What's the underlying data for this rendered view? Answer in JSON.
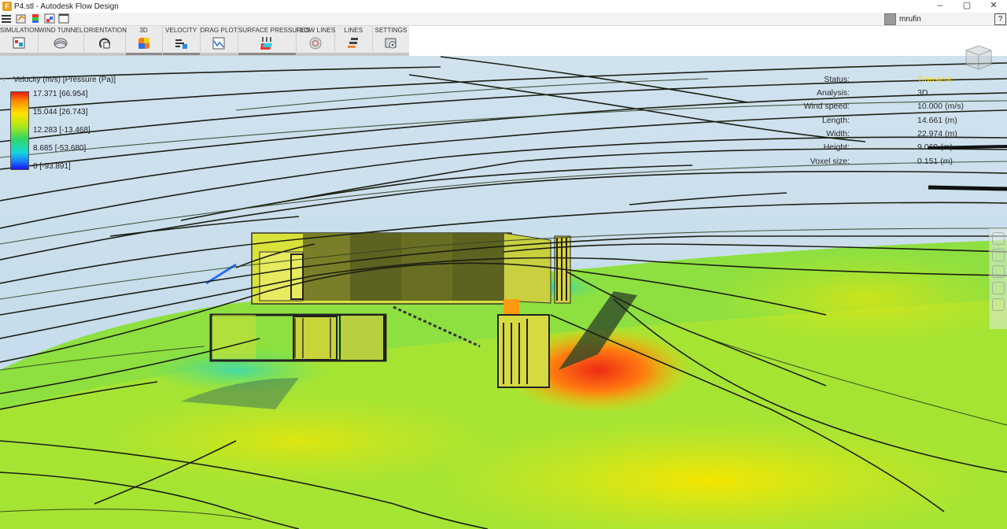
{
  "window": {
    "title": "P4.stl - Autodesk Flow Design",
    "controls": [
      "–",
      "▢",
      "✕"
    ]
  },
  "quickbar": {
    "user": "mrufin",
    "help": "?"
  },
  "ribbon": {
    "tabs": [
      {
        "label": "SIMULATION",
        "icon": "simulation-icon"
      },
      {
        "label": "WIND TUNNEL",
        "icon": "wind-tunnel-icon"
      },
      {
        "label": "ORIENTATION",
        "icon": "orientation-icon"
      },
      {
        "label": "3D",
        "icon": "3d-icon"
      },
      {
        "label": "VELOCITY",
        "icon": "velocity-icon"
      },
      {
        "label": "DRAG PLOT",
        "icon": "drag-plot-icon"
      },
      {
        "label": "SURFACE PRESSURES",
        "icon": "surface-pressures-icon"
      },
      {
        "label": "FLOW LINES",
        "icon": "flow-lines-icon"
      },
      {
        "label": "LINES",
        "icon": "lines-icon"
      },
      {
        "label": "SETTINGS",
        "icon": "settings-icon"
      }
    ]
  },
  "legend": {
    "title": "Velocity (m/s) [Pressure (Pa)]",
    "ticks": [
      "17.371 [66.954]",
      "15.044 [26.743]",
      "12.283 [-13.468]",
      "8.685 [-53.680]",
      "0 [-93.891]"
    ],
    "colors": [
      "#e81a0e",
      "#ffe400",
      "#34d860",
      "#12d8d8",
      "#1610f0"
    ]
  },
  "status": {
    "rows": [
      {
        "key": "Status:",
        "value": "Transient",
        "highlight": true
      },
      {
        "key": "Analysis:",
        "value": "3D"
      },
      {
        "key": "Wind speed:",
        "value": "10.000 (m/s)"
      },
      {
        "key": "Length:",
        "value": "14.661 (m)"
      },
      {
        "key": "Width:",
        "value": "22.974 (m)"
      },
      {
        "key": "Height:",
        "value": "9.069 (m)"
      },
      {
        "key": "Voxel size:",
        "value": "0.151 (m)"
      }
    ],
    "highlight_color": "#ffd800"
  },
  "tools": [
    "orbit-icon",
    "pan-icon",
    "zoom-icon",
    "zoom-extents-icon",
    "section-icon"
  ]
}
